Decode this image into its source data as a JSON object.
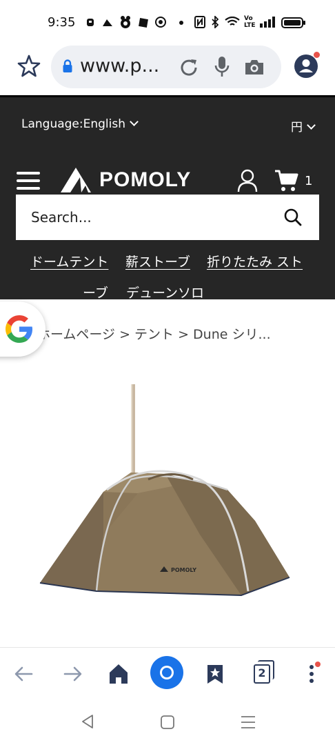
{
  "status_bar": {
    "time": "9:35",
    "icons": [
      "messenger-icon",
      "cloud-icon",
      "game-icon",
      "dropbox-icon",
      "hotspot-icon",
      "dot-icon",
      "nfc-icon",
      "bluetooth-icon",
      "wifi-icon",
      "volte-icon",
      "signal-icon",
      "battery-icon"
    ]
  },
  "browser": {
    "url": "www.p...",
    "colors": {
      "accent": "#1a73e8",
      "icon": "#5f6368",
      "nav_icon": "#2c3a5a"
    }
  },
  "site": {
    "language_label": "Language:English",
    "currency_label": "円",
    "logo_text": "POMOLY",
    "cart_count": "1",
    "search_placeholder": "Search...",
    "categories": [
      {
        "label": "ドームテント"
      },
      {
        "label": "薪ストーブ"
      },
      {
        "label": "折りたたみ スト"
      },
      {
        "label": "ーブ"
      },
      {
        "label": "デューンソロ"
      }
    ],
    "header_bg": "#262626"
  },
  "breadcrumb": {
    "text": "ホームページ > テント >  Dune シリ..."
  },
  "bottom_nav": {
    "tab_count": "2"
  }
}
